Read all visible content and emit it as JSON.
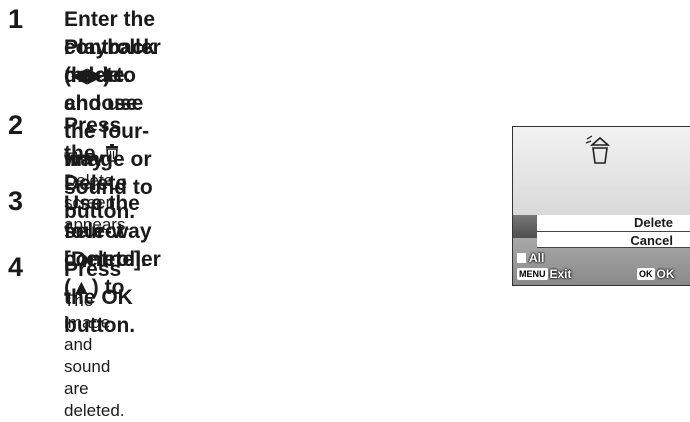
{
  "steps": [
    {
      "number": "1",
      "title_lines": [
        "Enter the Playback mode and use the four-way",
        "controller (◀▶) to choose the image or sound to",
        "delete."
      ]
    },
    {
      "number": "2",
      "title_before_icon": "Press the",
      "icon": "trash-icon",
      "title_after_icon": "Delete button.",
      "description": "The Delete screen appears."
    },
    {
      "number": "3",
      "title_lines": [
        "Use the four-way controller (▲) to",
        "select [Delete]."
      ]
    },
    {
      "number": "4",
      "title": "Press the OK button.",
      "description": "The image and sound are deleted."
    }
  ],
  "camera_screen": {
    "menu_items": [
      "Delete",
      "Cancel"
    ],
    "selected_item": "Cancel",
    "all_label": "All",
    "menu_badge": "MENU",
    "exit_label": "Exit",
    "ok_badge": "OK",
    "ok_label": "OK"
  }
}
